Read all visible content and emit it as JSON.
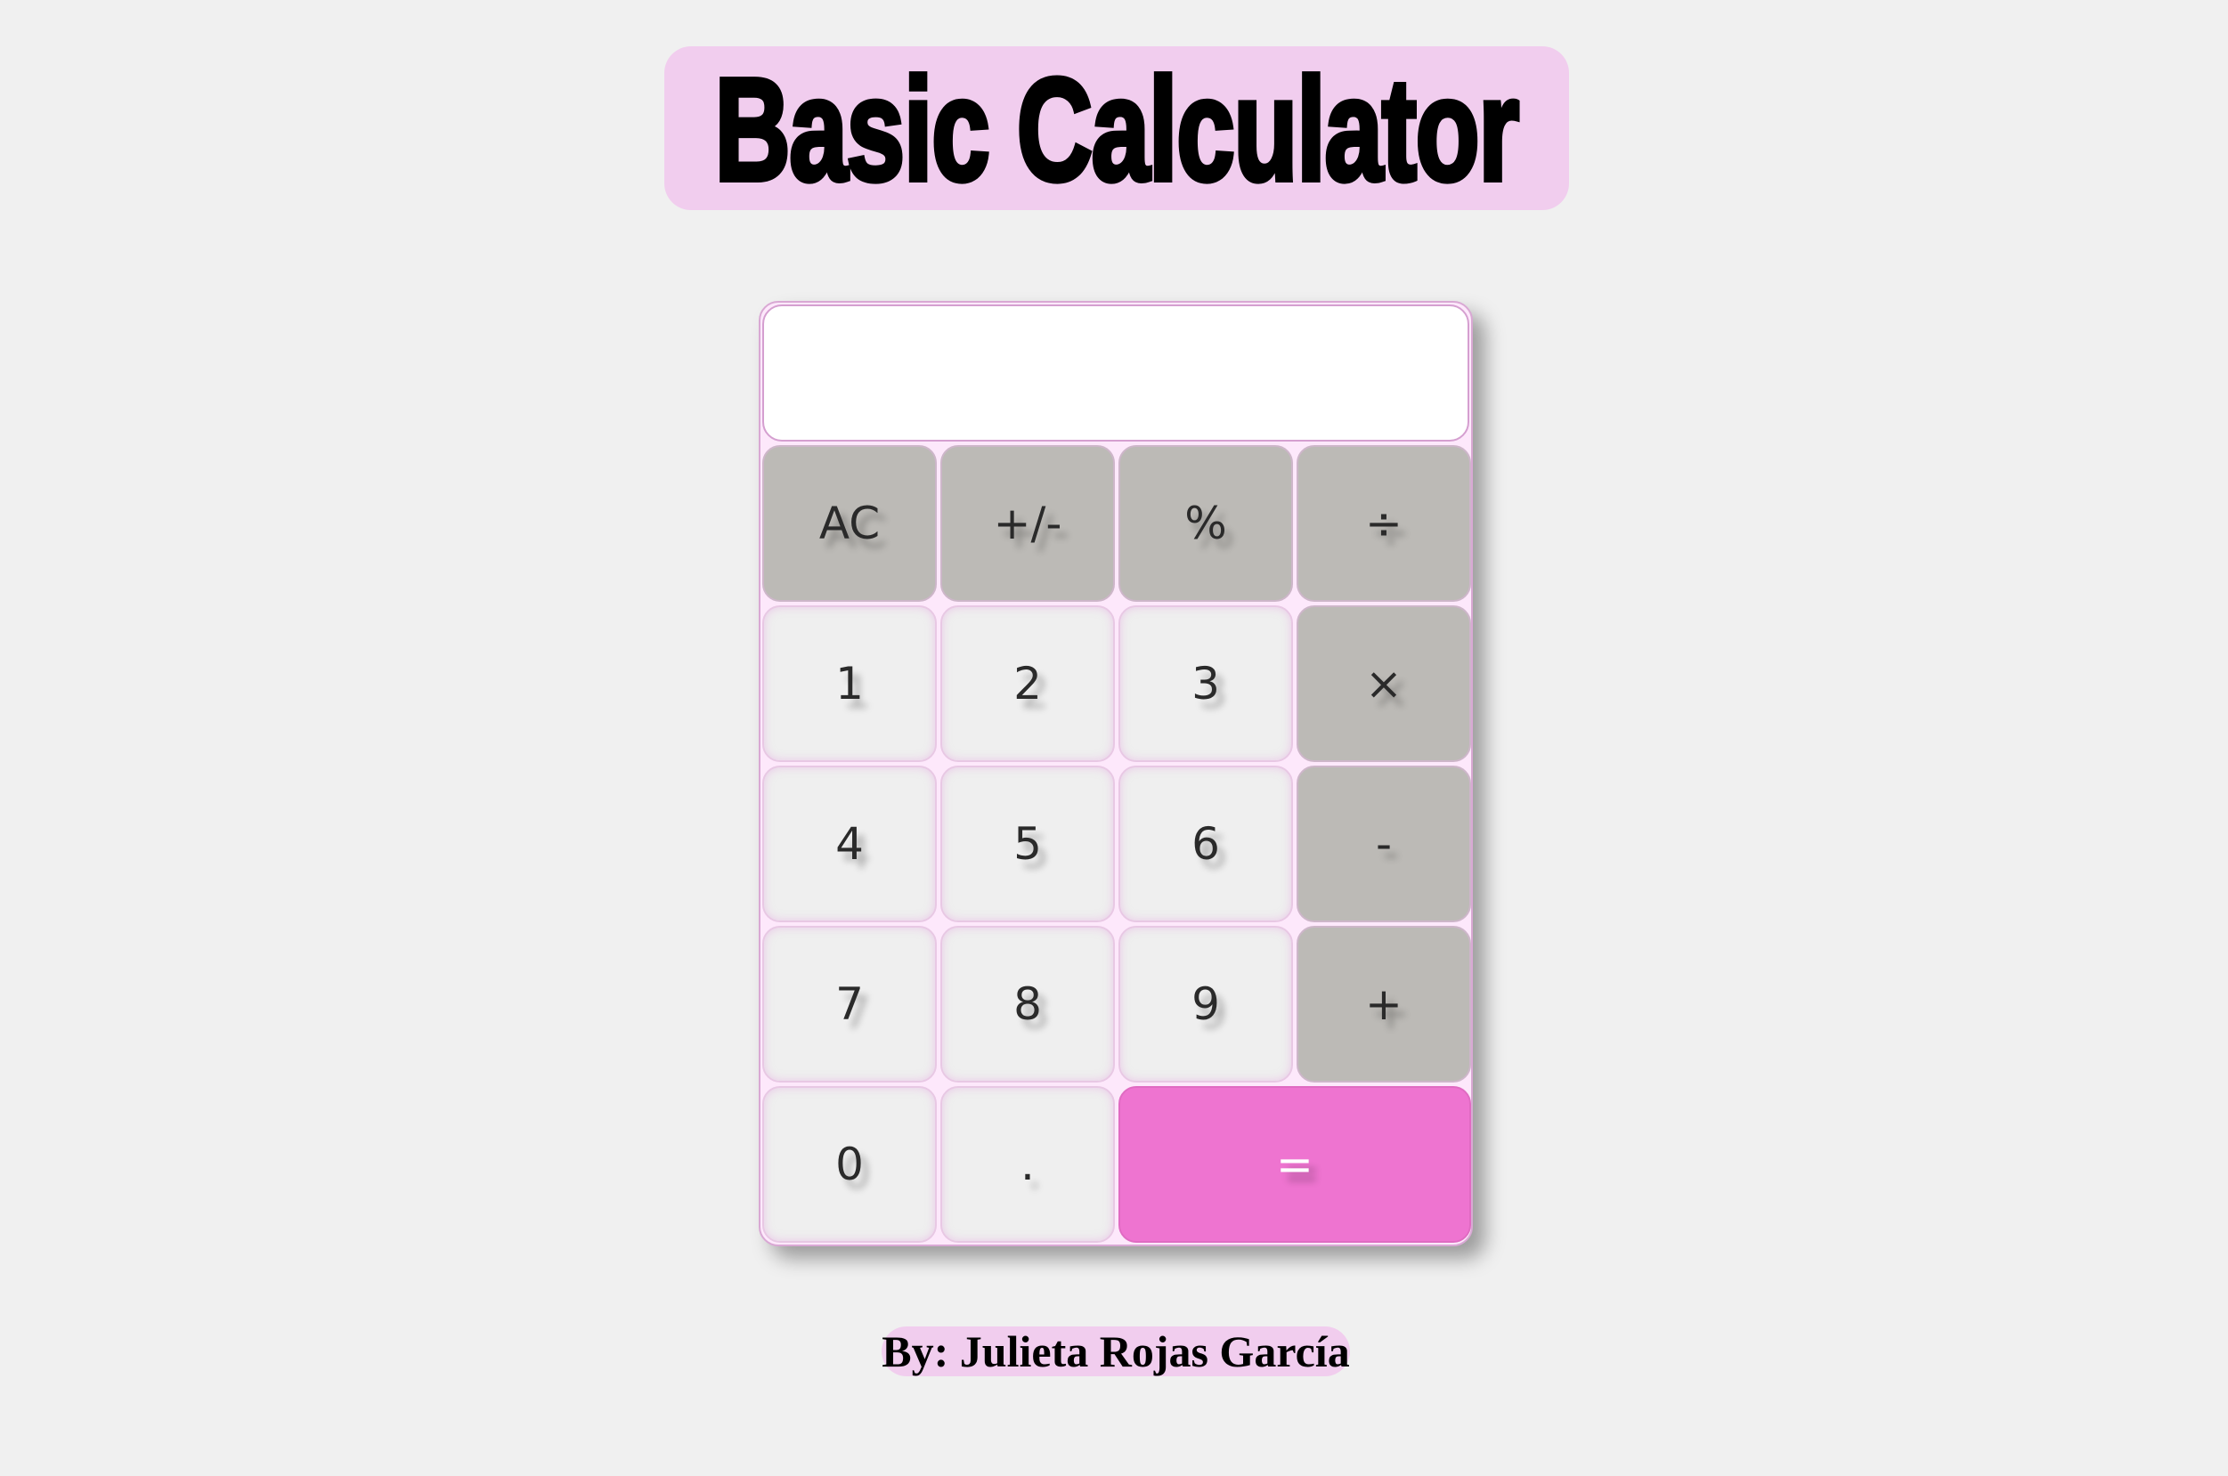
{
  "title": "Basic Calculator",
  "display": {
    "value": ""
  },
  "keys": {
    "ac": "AC",
    "sign": "+/-",
    "percent": "%",
    "divide": "÷",
    "one": "1",
    "two": "2",
    "three": "3",
    "multiply": "×",
    "four": "4",
    "five": "5",
    "six": "6",
    "minus": "-",
    "seven": "7",
    "eight": "8",
    "nine": "9",
    "plus": "+",
    "zero": "0",
    "decimal": ".",
    "equals": "="
  },
  "author": "By: Julieta Rojas García",
  "colors": {
    "background": "#f0f0f0",
    "title_highlight": "#f1cdee",
    "number_key": "#efefef",
    "function_key": "#bcbab6",
    "equals_key": "#ee74d0",
    "calculator_border": "#d9a8d4"
  }
}
